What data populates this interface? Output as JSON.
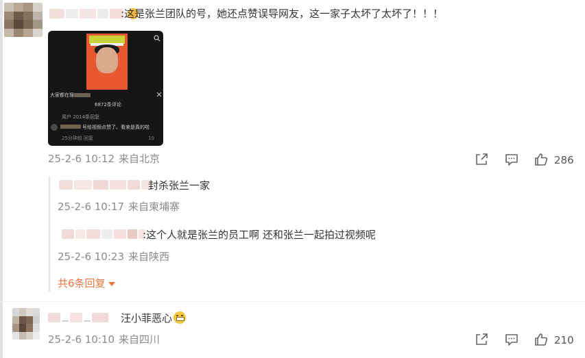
{
  "comments": [
    {
      "text": ":这是张兰团队的号，她还点赞误导网友，这一家子太坏了太坏了！！！",
      "date": "25-2-6 10:12",
      "location": "来自北京",
      "likes": "286",
      "video_preview": {
        "overlay_count": "6872条评论",
        "overlay_heading": "大家都在搜",
        "overlay_note": "用户 2014条回复",
        "overlay_snippet": "号给视频点赞了。看来是真的啦",
        "overlay_time": "25分钟前",
        "overlay_reply": "回复",
        "overlay_likes": "10"
      }
    },
    {
      "text": "汪小菲恶心",
      "date": "25-2-6 10:10",
      "location": "来自四川",
      "likes": "210",
      "emoji": "grimace-emoji"
    }
  ],
  "replies": [
    {
      "text": "封杀张兰一家",
      "date": "25-2-6 10:17",
      "location": "来自柬埔寨"
    },
    {
      "text": ":这个人就是张兰的员工啊 还和张兰一起拍过视频呢",
      "date": "25-2-6 10:23",
      "location": "来自陕西"
    }
  ],
  "more_replies": "共6条回复",
  "colors": {
    "accent": "#eb7340",
    "meta": "#8a8a8a",
    "text": "#333333"
  },
  "icons": [
    "share-icon",
    "comment-icon",
    "like-icon",
    "search-icon",
    "close-icon"
  ]
}
